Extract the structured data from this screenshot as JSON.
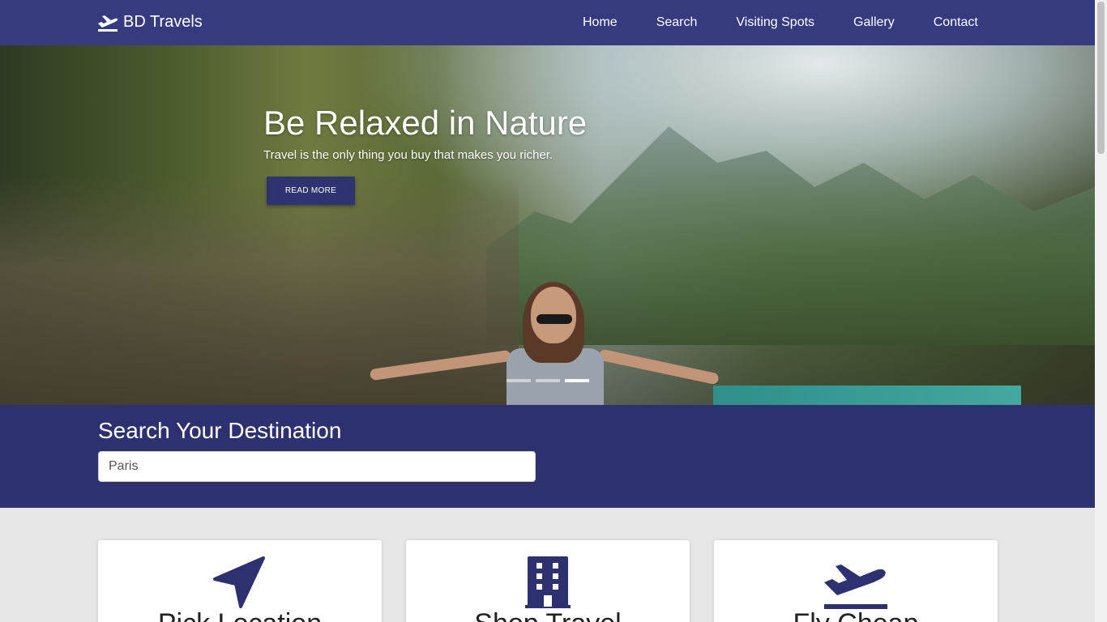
{
  "navbar": {
    "brand": "BD Travels",
    "links": [
      "Home",
      "Search",
      "Visiting Spots",
      "Gallery",
      "Contact"
    ]
  },
  "hero": {
    "title": "Be Relaxed in Nature",
    "subtitle": "Travel is the only thing you buy that makes you richer.",
    "button_label": "READ MORE",
    "slides": 3,
    "active_slide": 3
  },
  "search": {
    "title": "Search Your Destination",
    "value": "Paris"
  },
  "cards": [
    {
      "title": "Pick Location",
      "icon": "location-arrow-icon"
    },
    {
      "title": "Shop Travel",
      "icon": "building-icon"
    },
    {
      "title": "Fly Cheap",
      "icon": "plane-departure-icon"
    }
  ],
  "colors": {
    "primary": "#353b7e",
    "search_bg": "#2e3170",
    "button": "#2f336f",
    "page_bg": "#e6e6e6"
  }
}
